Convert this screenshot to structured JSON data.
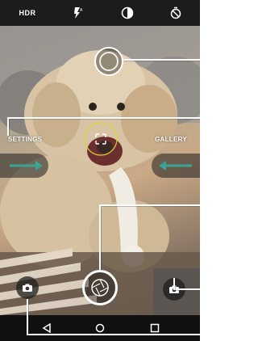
{
  "topbar": {
    "hdr_label": "HDR",
    "flash_icon": "flash-auto-icon",
    "filter_icon": "filter-icon",
    "timer_icon": "timer-icon"
  },
  "viewfinder": {
    "left_label": "SETTINGS",
    "right_label": "GALLERY",
    "focus_icon": "focus-frame-icon",
    "accent_color": "#3aa394",
    "focus_color": "#d8d23a"
  },
  "controls": {
    "switch_camera_icon": "switch-camera-icon",
    "shutter_icon": "shutter-icon",
    "video_icon": "camera-icon"
  },
  "navbar": {
    "back_icon": "back-icon",
    "home_icon": "home-icon",
    "recents_icon": "recents-icon"
  }
}
